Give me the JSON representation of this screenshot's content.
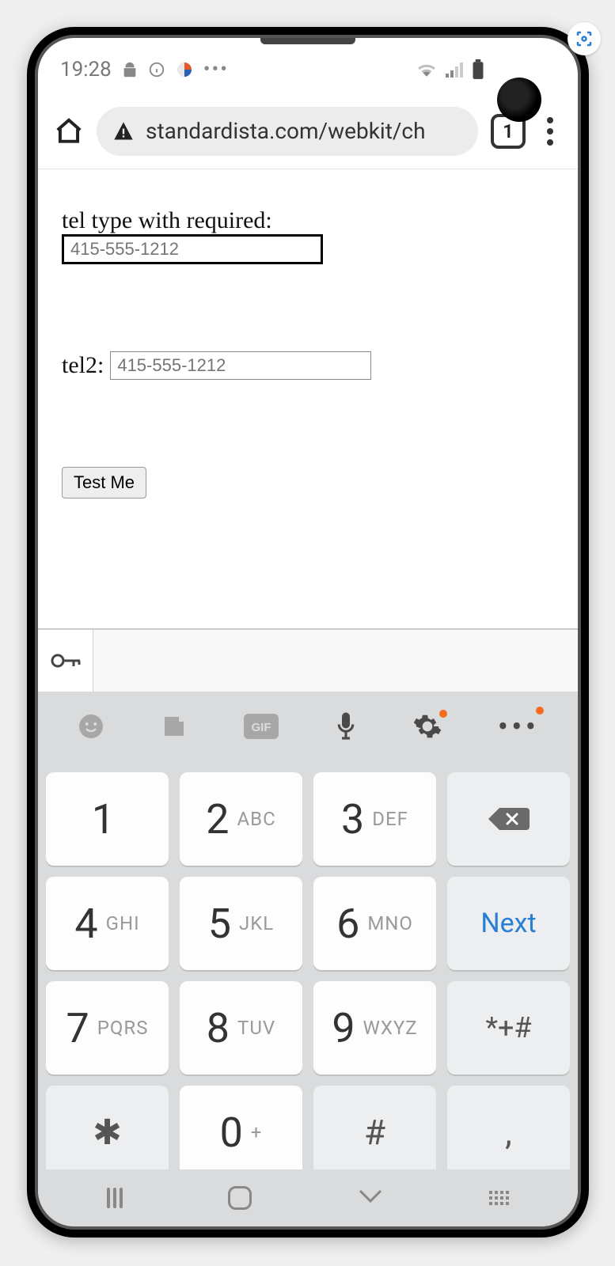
{
  "status": {
    "time": "19:28",
    "icons_left": [
      "android-icon",
      "info-icon",
      "twister-icon",
      "more-icon"
    ],
    "icons_right": [
      "wifi-icon",
      "signal-icon",
      "battery-icon"
    ]
  },
  "browser": {
    "url": "standardista.com/webkit/ch",
    "tab_count": "1"
  },
  "page": {
    "label1": "tel type with required:",
    "placeholder1": "415-555-1212",
    "label2": "tel2:",
    "placeholder2": "415-555-1212",
    "button": "Test Me"
  },
  "keyboard": {
    "toolbar": [
      "emoji-icon",
      "sticker-icon",
      "gif-icon",
      "mic-icon",
      "settings-icon",
      "more-icon"
    ],
    "keys": [
      {
        "d": "1",
        "s": ""
      },
      {
        "d": "2",
        "s": "ABC"
      },
      {
        "d": "3",
        "s": "DEF"
      },
      {
        "type": "backspace"
      },
      {
        "d": "4",
        "s": "GHI"
      },
      {
        "d": "5",
        "s": "JKL"
      },
      {
        "d": "6",
        "s": "MNO"
      },
      {
        "type": "next",
        "label": "Next"
      },
      {
        "d": "7",
        "s": "PQRS"
      },
      {
        "d": "8",
        "s": "TUV"
      },
      {
        "d": "9",
        "s": "WXYZ"
      },
      {
        "type": "sym",
        "label": "*+#"
      },
      {
        "type": "star",
        "label": "✱"
      },
      {
        "d": "0",
        "s": "+"
      },
      {
        "type": "hash",
        "label": "#"
      },
      {
        "type": "comma",
        "label": ","
      }
    ]
  }
}
